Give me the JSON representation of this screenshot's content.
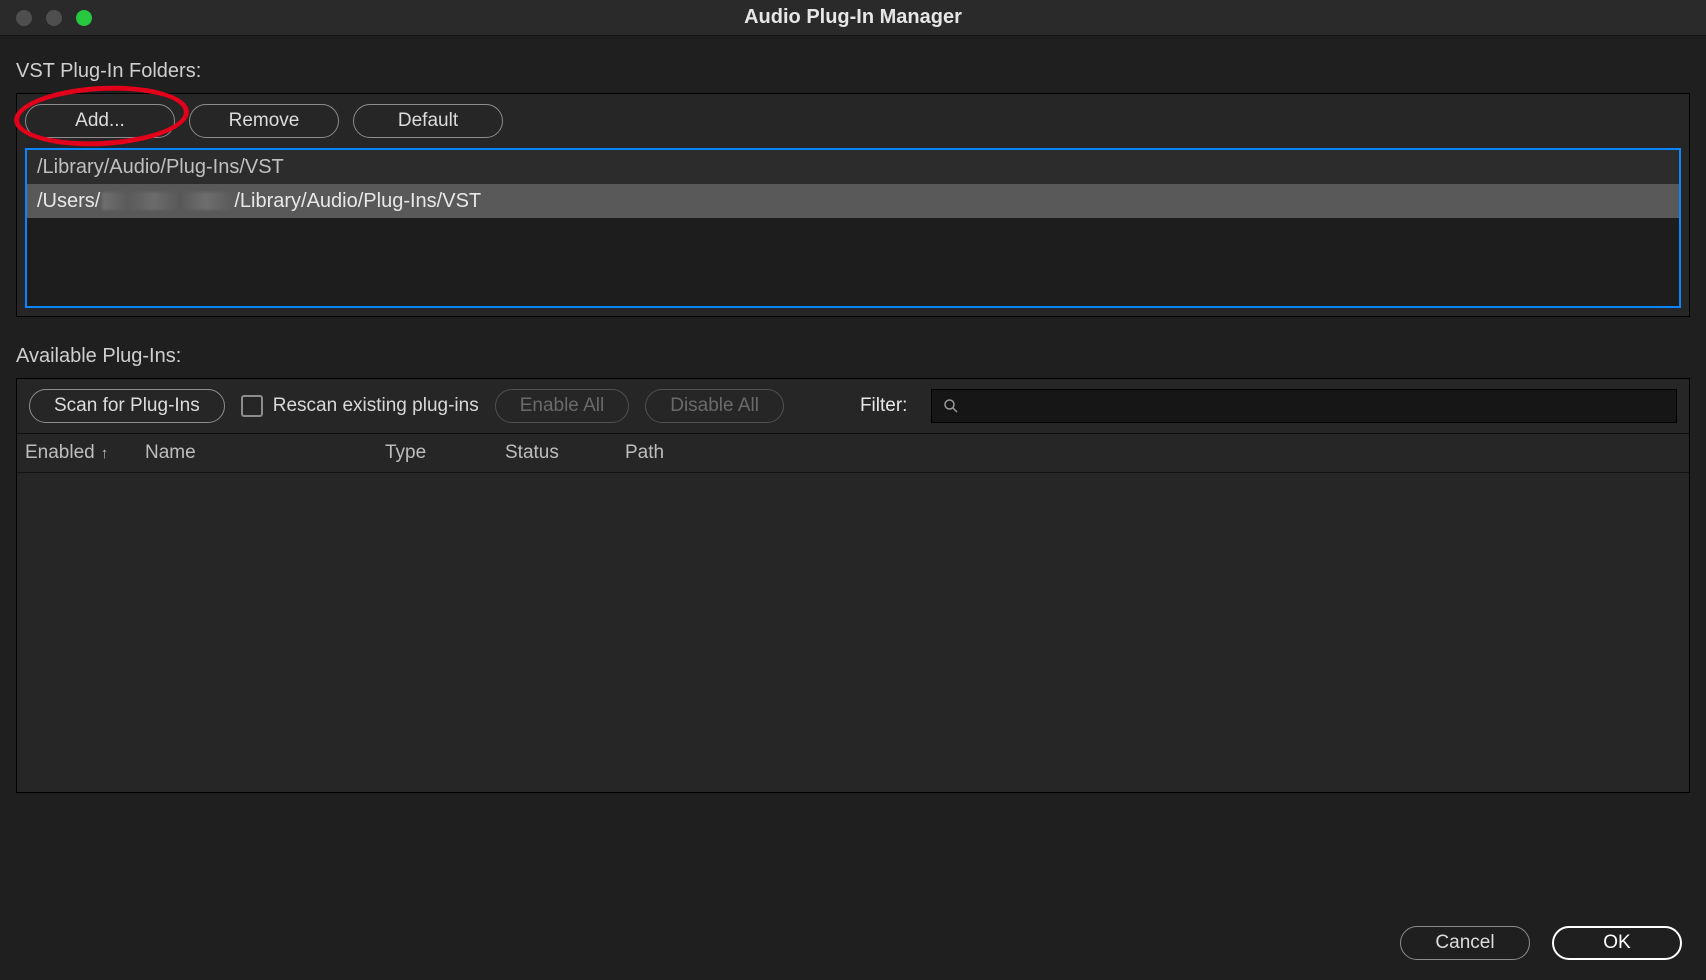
{
  "window": {
    "title": "Audio Plug-In Manager"
  },
  "folders_section": {
    "label": "VST Plug-In Folders:",
    "buttons": {
      "add": "Add...",
      "remove": "Remove",
      "default": "Default"
    },
    "rows": {
      "r0_text": "/Library/Audio/Plug-Ins/VST",
      "r1_prefix": "/Users/",
      "r1_suffix": "/Library/Audio/Plug-Ins/VST"
    }
  },
  "plugins_section": {
    "label": "Available Plug-Ins:",
    "scan": "Scan for Plug-Ins",
    "rescan": "Rescan existing plug-ins",
    "enable_all": "Enable All",
    "disable_all": "Disable All",
    "filter_label": "Filter:",
    "filter_value": "",
    "columns": {
      "enabled": "Enabled",
      "name": "Name",
      "type": "Type",
      "status": "Status",
      "path": "Path"
    }
  },
  "footer": {
    "cancel": "Cancel",
    "ok": "OK"
  }
}
